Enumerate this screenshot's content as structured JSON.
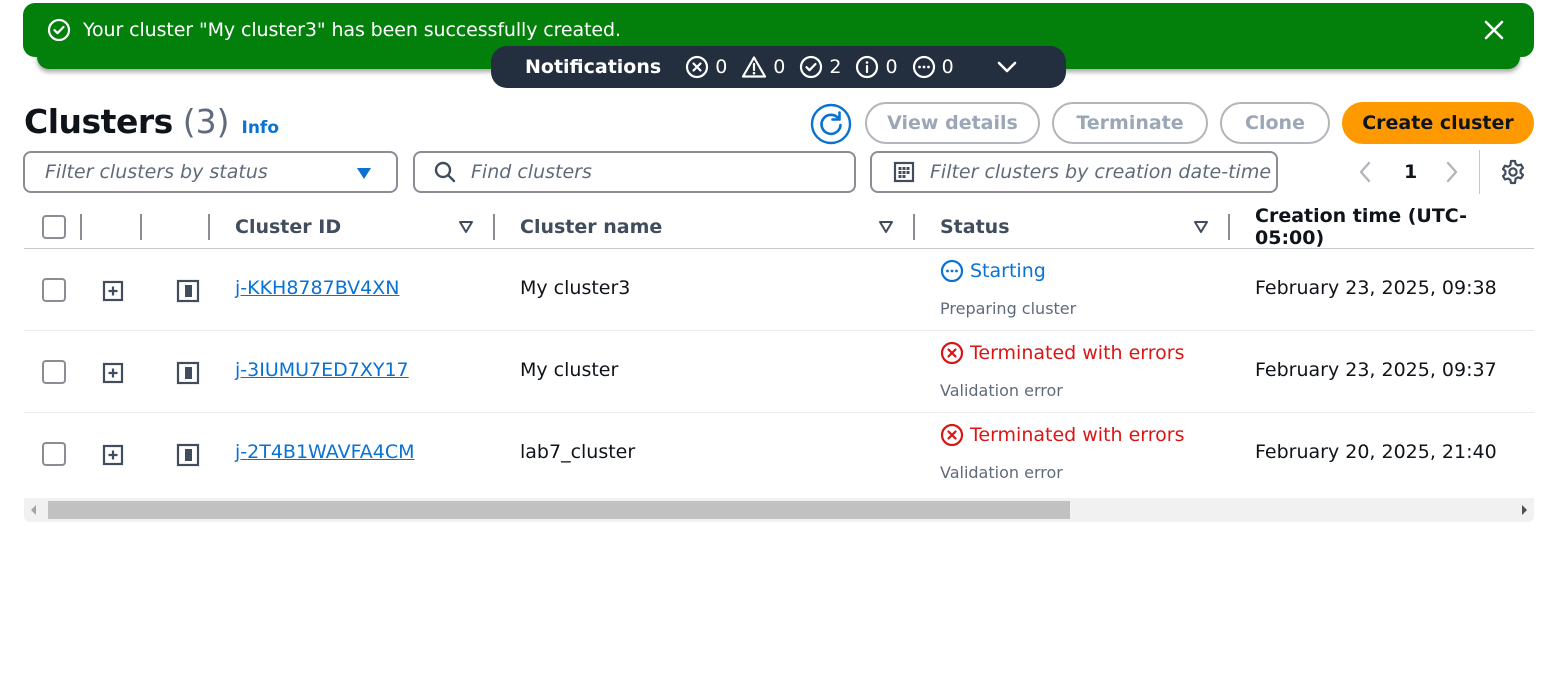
{
  "flash": {
    "message": "Your cluster \"My cluster3\" has been successfully created.",
    "color": "#037f0c",
    "icon": "success-check-icon",
    "close_icon": "close-icon"
  },
  "notifications": {
    "title": "Notifications",
    "counts": [
      {
        "icon": "error-icon",
        "value": "0"
      },
      {
        "icon": "warning-icon",
        "value": "0"
      },
      {
        "icon": "success-icon",
        "value": "2"
      },
      {
        "icon": "info-icon",
        "value": "0"
      },
      {
        "icon": "in-progress-icon",
        "value": "0"
      }
    ]
  },
  "header": {
    "title": "Clusters",
    "count": "(3)",
    "info": "Info"
  },
  "actions": {
    "view_details": "View details",
    "terminate": "Terminate",
    "clone": "Clone",
    "create": "Create cluster",
    "primary_color": "#ff9900"
  },
  "filters": {
    "status_placeholder": "Filter clusters by status",
    "find_placeholder": "Find clusters",
    "date_placeholder": "Filter clusters by creation date-time"
  },
  "pagination": {
    "current_page": "1"
  },
  "table": {
    "columns": [
      "Cluster ID",
      "Cluster name",
      "Status",
      "Creation time (UTC-05:00)"
    ],
    "rows": [
      {
        "id": "j-KKH8787BV4XN",
        "name": "My cluster3",
        "status": "Starting",
        "status_type": "in-progress",
        "reason": "Preparing cluster",
        "created": "February 23, 2025, 09:38"
      },
      {
        "id": "j-3IUMU7ED7XY17",
        "name": "My cluster",
        "status": "Terminated with errors",
        "status_type": "error",
        "reason": "Validation error",
        "created": "February 23, 2025, 09:37"
      },
      {
        "id": "j-2T4B1WAVFA4CM",
        "name": "lab7_cluster",
        "status": "Terminated with errors",
        "status_type": "error",
        "reason": "Validation error",
        "created": "February 20, 2025, 21:40"
      }
    ]
  },
  "colors": {
    "link": "#0972d3",
    "error": "#d91515",
    "notification_bar": "#232f3e"
  }
}
